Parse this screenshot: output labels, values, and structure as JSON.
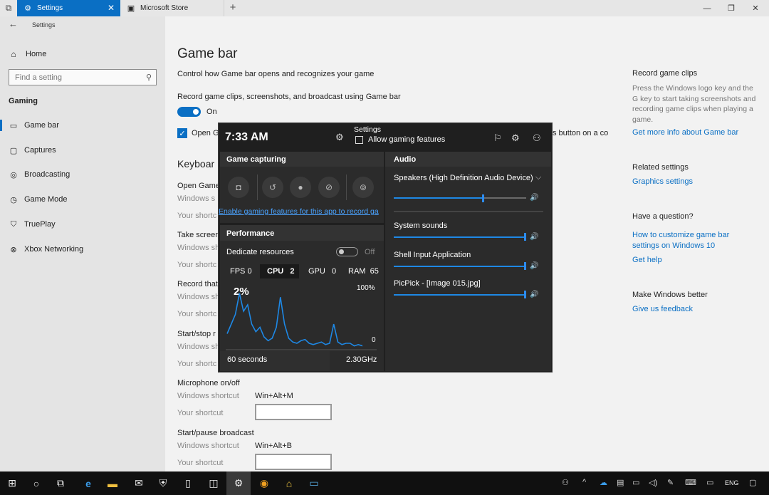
{
  "tabs": [
    {
      "label": "Settings",
      "icon": "gear-icon"
    },
    {
      "label": "Microsoft Store",
      "icon": "store-icon"
    }
  ],
  "sidebar": {
    "app_title": "Settings",
    "home_label": "Home",
    "search_placeholder": "Find a setting",
    "section": "Gaming",
    "items": [
      {
        "label": "Game bar",
        "icon": "gamebar-icon"
      },
      {
        "label": "Captures",
        "icon": "captures-icon"
      },
      {
        "label": "Broadcasting",
        "icon": "broadcast-icon"
      },
      {
        "label": "Game Mode",
        "icon": "gamemode-icon"
      },
      {
        "label": "TruePlay",
        "icon": "trueplay-icon"
      },
      {
        "label": "Xbox Networking",
        "icon": "xbox-icon"
      }
    ]
  },
  "main": {
    "title": "Game bar",
    "subtitle": "Control how Game bar opens and recognizes your game",
    "record_label": "Record game clips, screenshots, and broadcast using Game bar",
    "toggle_state": "On",
    "open_label_start": "Open G",
    "open_label_end": "s button on a co",
    "keyboard_title": "Keyboar",
    "shortcuts": [
      {
        "title": "Open Game",
        "win_label": "Windows s",
        "your_label": "Your shortc"
      },
      {
        "title": "Take screen",
        "win_label": "Windows sh",
        "your_label": "Your shortc"
      },
      {
        "title": "Record that",
        "win_label": "Windows sh",
        "your_label": "Your shortc"
      },
      {
        "title": "Start/stop r",
        "win_label": "Windows sh",
        "your_label": "Your shortc"
      },
      {
        "title": "Microphone on/off",
        "win_label": "Windows shortcut",
        "win_value": "Win+Alt+M",
        "your_label": "Your shortcut"
      },
      {
        "title": "Start/pause broadcast",
        "win_label": "Windows shortcut",
        "win_value": "Win+Alt+B",
        "your_label": "Your shortcut"
      }
    ]
  },
  "right": {
    "record_title": "Record game clips",
    "record_body": "Press the Windows logo key and the G key to start taking screenshots and recording game clips when playing a game.",
    "record_link": "Get more info about Game bar",
    "related_title": "Related settings",
    "related_link": "Graphics settings",
    "question_title": "Have a question?",
    "question_link": "How to customize game bar settings on Windows 10",
    "help_link": "Get help",
    "better_title": "Make Windows better",
    "feedback_link": "Give us feedback"
  },
  "gamebar": {
    "time": "7:33 AM",
    "settings_label": "Settings",
    "allow_label": "Allow gaming features",
    "capture_title": "Game capturing",
    "capture_link": "Enable gaming features for this app to record ga",
    "performance_title": "Performance",
    "dedicate_label": "Dedicate resources",
    "dedicate_state": "Off",
    "stats": [
      {
        "label": "FPS",
        "value": "0"
      },
      {
        "label": "CPU",
        "value": "2"
      },
      {
        "label": "GPU",
        "value": "0"
      },
      {
        "label": "RAM",
        "value": "65"
      }
    ],
    "cpu_percent": "2%",
    "graph_max": "100%",
    "graph_min": "0",
    "graph_span": "60 seconds",
    "graph_freq": "2.30GHz",
    "cpu_samples": [
      25,
      40,
      55,
      88,
      60,
      70,
      40,
      28,
      35,
      20,
      14,
      18,
      35,
      82,
      40,
      18,
      12,
      10,
      14,
      16,
      10,
      8,
      10,
      12,
      8,
      10,
      40,
      12,
      8,
      10,
      10,
      6,
      8,
      6
    ],
    "audio_title": "Audio",
    "device": "Speakers (High Definition Audio Device)",
    "device_volume": 0.67,
    "apps": [
      {
        "name": "System sounds",
        "volume": 1.0
      },
      {
        "name": "Shell Input Application",
        "volume": 1.0
      },
      {
        "name": "PicPick - [Image 015.jpg]",
        "volume": 1.0
      }
    ]
  },
  "taskbar": {
    "lang": "ENG"
  }
}
